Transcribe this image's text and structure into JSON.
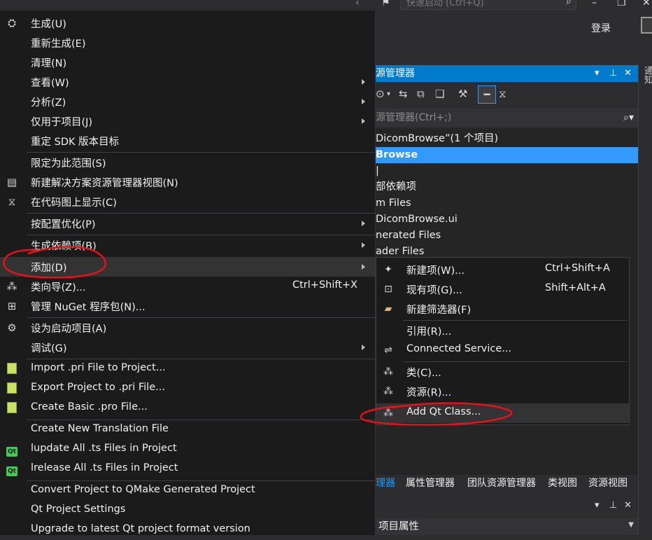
{
  "titlebar": {
    "quick_launch_placeholder": "快速启动 (Ctrl+Q)",
    "login_label": "登录",
    "right_strip_label": "通知"
  },
  "solution_explorer": {
    "title": "源管理器",
    "search_placeholder": "源管理器(Ctrl+;)",
    "tree": [
      {
        "label": "DicomBrowse”(1 个项目)",
        "selected": false
      },
      {
        "label": "Browse",
        "selected": true
      },
      {
        "label": "|",
        "selected": false
      },
      {
        "label": "部依赖项",
        "selected": false
      },
      {
        "label": "m Files",
        "selected": false
      },
      {
        "label": "DicomBrowse.ui",
        "selected": false
      },
      {
        "label": "nerated Files",
        "selected": false
      },
      {
        "label": "ader Files",
        "selected": false
      }
    ],
    "tabs": [
      {
        "label": "理器",
        "active": true
      },
      {
        "label": "属性管理器",
        "active": false
      },
      {
        "label": "团队资源管理器",
        "active": false
      },
      {
        "label": "类视图",
        "active": false
      },
      {
        "label": "资源视图",
        "active": false
      }
    ],
    "properties_combo": "项目属性"
  },
  "context_menu": {
    "items": [
      {
        "label": "生成(U)",
        "icon": "build-icon"
      },
      {
        "label": "重新生成(E)"
      },
      {
        "label": "清理(N)"
      },
      {
        "label": "查看(W)",
        "submenu": true
      },
      {
        "label": "分析(Z)",
        "submenu": true
      },
      {
        "label": "仅用于项目(J)",
        "submenu": true
      },
      {
        "label": "重定 SDK 版本目标"
      },
      {
        "label": "限定为此范围(S)"
      },
      {
        "label": "新建解决方案资源管理器视图(N)",
        "icon": "new-view-icon"
      },
      {
        "label": "在代码图上显示(C)",
        "icon": "code-map-icon"
      },
      {
        "label": "按配置优化(P)",
        "submenu": true
      },
      {
        "label": "生成依赖项(B)",
        "submenu": true
      },
      {
        "label": "添加(D)",
        "submenu": true,
        "highlighted": true
      },
      {
        "label": "类向导(Z)...",
        "shortcut": "Ctrl+Shift+X",
        "icon": "class-wizard-icon"
      },
      {
        "label": "管理 NuGet 程序包(N)...",
        "icon": "nuget-icon"
      },
      {
        "label": "设为启动项目(A)",
        "icon": "gear-icon"
      },
      {
        "label": "调试(G)",
        "submenu": true
      },
      {
        "label": "Import .pri File to Project...",
        "icon": "pri-import-icon"
      },
      {
        "label": "Export Project to .pri File...",
        "icon": "pri-export-icon"
      },
      {
        "label": "Create Basic .pro File...",
        "icon": "pro-create-icon"
      },
      {
        "label": "Create New Translation File"
      },
      {
        "label": "lupdate All .ts Files in Project",
        "icon": "qt-icon"
      },
      {
        "label": "lrelease All .ts Files in Project",
        "icon": "qt-icon"
      },
      {
        "label": "Convert Project to QMake Generated Project"
      },
      {
        "label": "Qt Project Settings"
      },
      {
        "label": "Upgrade to latest Qt project format version"
      }
    ]
  },
  "add_submenu": {
    "items": [
      {
        "label": "新建项(W)...",
        "shortcut": "Ctrl+Shift+A",
        "icon": "new-item-icon"
      },
      {
        "label": "现有项(G)...",
        "shortcut": "Shift+Alt+A",
        "icon": "existing-item-icon"
      },
      {
        "label": "新建筛选器(F)",
        "icon": "new-filter-folder-icon"
      },
      {
        "label": "引用(R)..."
      },
      {
        "label": "Connected Service...",
        "icon": "connected-service-icon"
      },
      {
        "label": "类(C)...",
        "icon": "class-icon"
      },
      {
        "label": "资源(R)...",
        "icon": "resource-icon"
      },
      {
        "label": "Add Qt Class...",
        "icon": "qt-class-icon",
        "highlighted": true
      }
    ]
  },
  "colors": {
    "accent_blue": "#007acc",
    "selection_blue": "#3399ff",
    "annotation_red": "#e8101a",
    "menu_bg": "#1b1b1c"
  }
}
